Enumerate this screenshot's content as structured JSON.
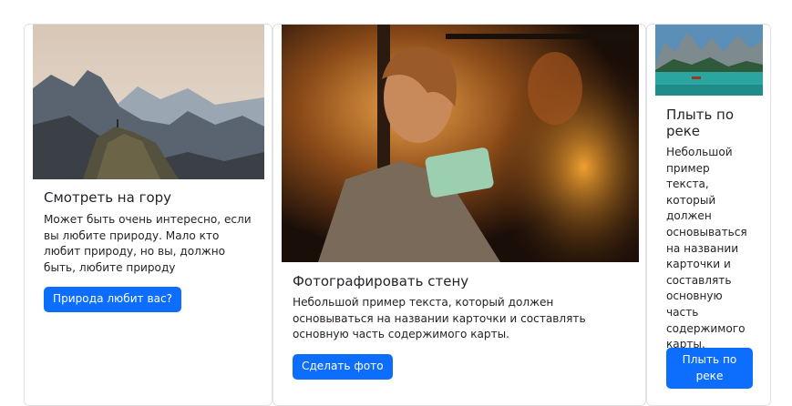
{
  "cards": [
    {
      "image_alt": "mountain-photo",
      "title": "Смотреть на гору",
      "text": "Может быть очень интересно, если вы любите природу. Мало кто любит природу, но вы, должно быть, любите природу",
      "button": "Природа любит вас?"
    },
    {
      "image_alt": "woman-with-phone-photo",
      "title": "Фотографировать стену",
      "text": "Небольшой пример текста, который должен основываться на названии карточки и составлять основную часть содержимого карты.",
      "button": "Сделать фото"
    },
    {
      "image_alt": "lake-boat-photo",
      "title": "Плыть по реке",
      "text": "Небольшой пример текста, который должен основываться на названии карточки и составлять основную часть содержимого карты.",
      "button": "Плыть по реке"
    }
  ],
  "colors": {
    "button": "#0d6efd",
    "card_border": "#dfe1e4"
  }
}
